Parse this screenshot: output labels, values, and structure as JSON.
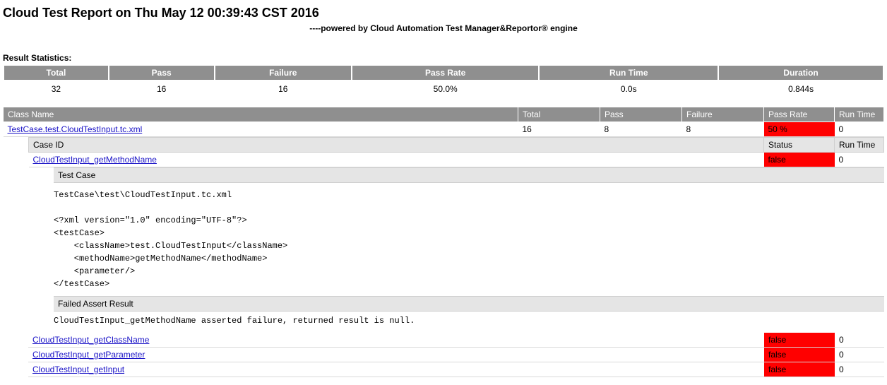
{
  "title": "Cloud Test Report on Thu May 12 00:39:43 CST 2016",
  "subtitle": "----powered by Cloud Automation Test Manager&Reportor® engine",
  "stats_label": "Result Statistics:",
  "stats": {
    "headers": {
      "total": "Total",
      "pass": "Pass",
      "failure": "Failure",
      "passrate": "Pass Rate",
      "runtime": "Run Time",
      "duration": "Duration"
    },
    "values": {
      "total": "32",
      "pass": "16",
      "failure": "16",
      "passrate": "50.0%",
      "runtime": "0.0s",
      "duration": "0.844s"
    }
  },
  "class_headers": {
    "classname": "Class Name",
    "total": "Total",
    "pass": "Pass",
    "failure": "Failure",
    "passrate": "Pass Rate",
    "runtime": "Run Time"
  },
  "class_row": {
    "name": "TestCase.test.CloudTestInput.tc.xml",
    "total": "16",
    "pass": "8",
    "failure": "8",
    "passrate": "50 %",
    "runtime": "0"
  },
  "case_headers": {
    "caseid": "Case ID",
    "status": "Status",
    "runtime": "Run Time"
  },
  "case_expanded": {
    "name": "CloudTestInput_getMethodName",
    "status": "false",
    "runtime": "0",
    "test_case_label": "Test Case",
    "test_case_source": "TestCase\\test\\CloudTestInput.tc.xml\n\n<?xml version=\"1.0\" encoding=\"UTF-8\"?>\n<testCase>\n    <className>test.CloudTestInput</className>\n    <methodName>getMethodName</methodName>\n    <parameter/>\n</testCase>",
    "failed_label": "Failed Assert Result",
    "failed_text": "CloudTestInput_getMethodName asserted failure, returned result is null."
  },
  "other_cases": [
    {
      "name": "CloudTestInput_getClassName",
      "status": "false",
      "runtime": "0"
    },
    {
      "name": "CloudTestInput_getParameter",
      "status": "false",
      "runtime": "0"
    },
    {
      "name": "CloudTestInput_getInput",
      "status": "false",
      "runtime": "0"
    }
  ]
}
